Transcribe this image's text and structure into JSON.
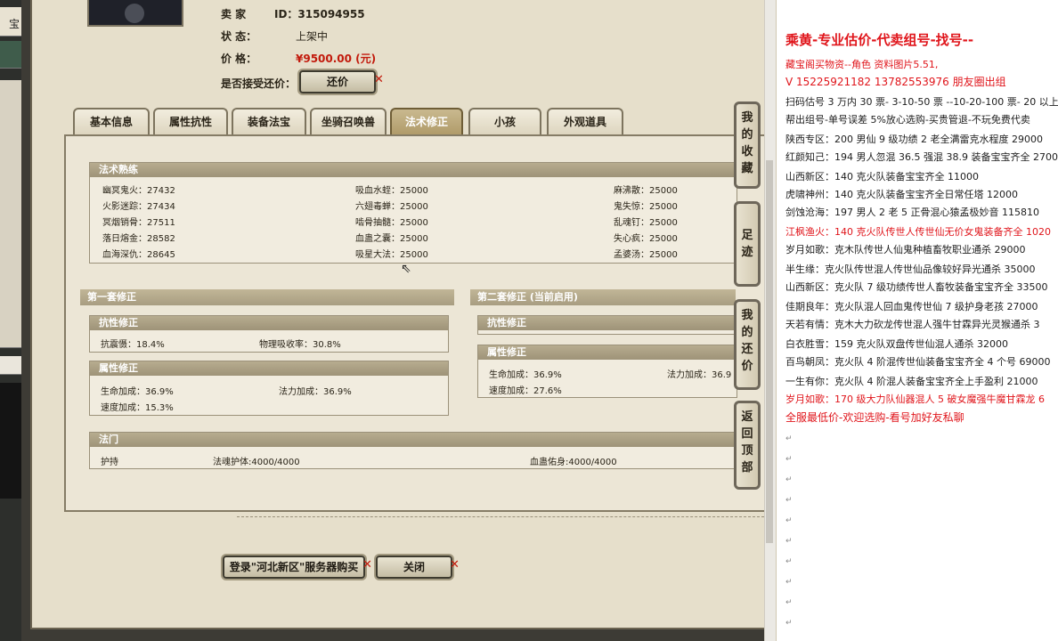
{
  "seller": {
    "seller_label": "卖  家",
    "seller_value": "ID：315094955",
    "status_label": "状       态：",
    "status_value": "上架中",
    "price_label": "价       格：",
    "price_value": "¥9500.00 (元)",
    "counter_label": "是否接受还价：",
    "counter_button": "还价"
  },
  "tabs": [
    {
      "label": "基本信息"
    },
    {
      "label": "属性抗性"
    },
    {
      "label": "装备法宝"
    },
    {
      "label": "坐骑召唤兽"
    },
    {
      "label": "法术修正",
      "active": true
    },
    {
      "label": "小孩"
    },
    {
      "label": "外观道具"
    }
  ],
  "spell_mastery": {
    "title": "法术熟练",
    "rows": [
      [
        "幽冥鬼火：27432",
        "吸血水蛭：25000",
        "麻沸散：25000"
      ],
      [
        "火影迷踪：27434",
        "六翅毒蝉：25000",
        "鬼失惊：25000"
      ],
      [
        "冥烟销骨：27511",
        "啮骨抽髓：25000",
        "乱魂钉：25000"
      ],
      [
        "落日熔金：28582",
        "血蛊之囊：25000",
        "失心疯：25000"
      ],
      [
        "血海深仇：28645",
        "吸星大法：25000",
        "孟婆汤：25000"
      ]
    ]
  },
  "set1": {
    "title": "第一套修正",
    "resist_title": "抗性修正",
    "resist_items": [
      "抗震慑：18.4%",
      "物理吸收率：30.8%"
    ],
    "attr_title": "属性修正",
    "attr_items": [
      "生命加成：36.9%",
      "法力加成：36.9%",
      "速度加成：15.3%"
    ]
  },
  "set2": {
    "title": "第二套修正 (当前启用)",
    "resist_title": "抗性修正",
    "attr_title": "属性修正",
    "attr_items": [
      "生命加成：36.9%",
      "法力加成：36.9",
      "速度加成：27.6%"
    ]
  },
  "fa_men": {
    "title": "法门",
    "items": [
      "护持",
      "法魂护体:4000/4000",
      "血蛊佑身:4000/4000"
    ]
  },
  "footer": {
    "login_button": "登录\"河北新区\"服务器购买",
    "close_button": "关闭"
  },
  "side_tabs": [
    "我的收藏",
    "足迹",
    "我的还价",
    "返回顶部"
  ],
  "left_strip": {
    "label": "宝"
  },
  "doc_lines": [
    {
      "text": "乘黄-专业估价-代卖组号-找号--",
      "color": "red",
      "size": "title"
    },
    {
      "text": "藏宝阁买物资--角色  资料图片5.51,",
      "color": "red"
    },
    {
      "text": "V 15225921182       13782553976 朋友圈出组",
      "color": "red",
      "size": "big"
    },
    {
      "text": "扫码估号 3 万内 30 票- 3-10-50 票  --10-20-100 票- 20 以上 1"
    },
    {
      "text": "帮出组号-单号误差 5%放心选购-买贵管退-不玩免费代卖"
    },
    {
      "text": "陕西专区：200 男仙 9 级功绩 2 老全满雷克水程度 29000"
    },
    {
      "text": "红颜知己：194 男人忽混 36.5 强混 38.9 装备宝宝齐全 27000"
    },
    {
      "text": "山西新区：140 克火队装备宝宝齐全 11000"
    },
    {
      "text": "虎啸神州：140 克火队装备宝宝齐全日常任塔 12000"
    },
    {
      "text": "剑蚀沧海：197 男人 2 老 5 正骨混心猿孟极妙音 115810"
    },
    {
      "text": "江枫渔火：140 克火队传世人传世仙无价女鬼装备齐全 1020",
      "color": "red"
    },
    {
      "text": "岁月如歌：克木队传世人仙鬼种植畜牧职业通杀 29000"
    },
    {
      "text": "半生缘：克火队传世混人传世仙品像较好异光通杀 35000"
    },
    {
      "text": "山西新区：克火队 7 级功绩传世人畜牧装备宝宝齐全 33500"
    },
    {
      "text": "佳期良年：克火队混人回血鬼传世仙 7 级护身老孩 27000"
    },
    {
      "text": "天若有情：克木大力砍龙传世混人强牛甘霖异光灵猴通杀 3"
    },
    {
      "text": "白衣胜雪：159 克火队双盘传世仙混人通杀 32000"
    },
    {
      "text": "百鸟朝凤：克火队 4 阶混传世仙装备宝宝齐全 4 个号 69000"
    },
    {
      "text": "一生有你：克火队 4 阶混人装备宝宝齐全上手盈利 21000"
    },
    {
      "text": "岁月如歌：170 级大力队仙器混人 5 破女魔强牛魔甘霖龙 6",
      "color": "red"
    },
    {
      "text": "全服最低价-欢迎选购-看号加好友私聊",
      "color": "red",
      "size": "big"
    }
  ],
  "colors": {
    "accent_red": "#c21a0c",
    "doc_red": "#e0151b",
    "panel_bg": "#e6dfcb",
    "tab_active": "#b09b6a"
  }
}
